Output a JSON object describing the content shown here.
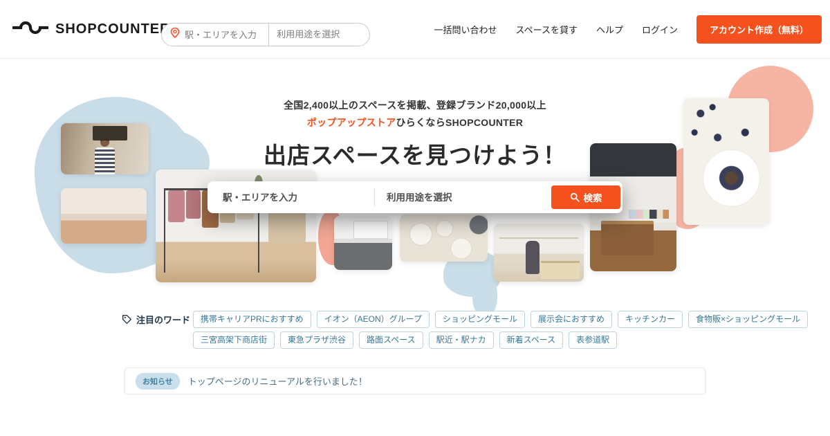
{
  "header": {
    "logo_text": "SHOPCOUNTER",
    "search": {
      "area_placeholder": "駅・エリアを入力",
      "usage_placeholder": "利用用途を選択"
    },
    "nav": [
      "一括問い合わせ",
      "スペースを貸す",
      "ヘルプ",
      "ログイン"
    ],
    "cta_label": "アカウント作成（無料）"
  },
  "hero": {
    "stats_line": "全国2,400以上のスペースを掲載、登録ブランド20,000以上",
    "tagline_highlight": "ポップアップストア",
    "tagline_rest": "ひらくならSHOPCOUNTER",
    "title": "出店スペースを見つけよう！",
    "search": {
      "area_placeholder": "駅・エリアを入力",
      "usage_placeholder": "利用用途を選択",
      "button_label": "検索"
    },
    "photos": [
      "cafe-owner",
      "bright-room",
      "clothing-racks",
      "dark-floor-room",
      "ceramic-tableware",
      "select-shop",
      "apparel-shop-counter",
      "blueberry-dessert"
    ]
  },
  "keywords": {
    "label": "注目のワード",
    "tags": [
      "携帯キャリアPRにおすすめ",
      "イオン（AEON）グループ",
      "ショッピングモール",
      "展示会におすすめ",
      "キッチンカー",
      "食物販×ショッピングモール",
      "三宮高架下商店街",
      "東急プラザ渋谷",
      "路面スペース",
      "駅近・駅ナカ",
      "新着スペース",
      "表参道駅"
    ]
  },
  "notice": {
    "badge": "お知らせ",
    "message": "トップページのリニューアルを行いました！"
  },
  "colors": {
    "brand_orange": "#f4511e",
    "accent_light_blue": "#c9dde8",
    "accent_salmon": "#f6b5a3",
    "tag_text": "#36789a"
  }
}
